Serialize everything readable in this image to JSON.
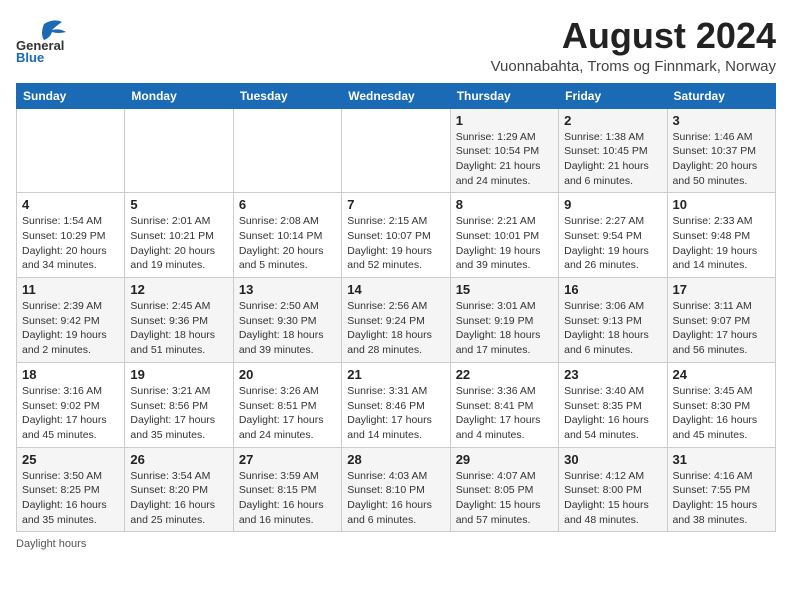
{
  "logo": {
    "line1": "General",
    "line2": "Blue"
  },
  "title": "August 2024",
  "subtitle": "Vuonnabahta, Troms og Finnmark, Norway",
  "days_of_week": [
    "Sunday",
    "Monday",
    "Tuesday",
    "Wednesday",
    "Thursday",
    "Friday",
    "Saturday"
  ],
  "weeks": [
    [
      {
        "day": "",
        "info": ""
      },
      {
        "day": "",
        "info": ""
      },
      {
        "day": "",
        "info": ""
      },
      {
        "day": "",
        "info": ""
      },
      {
        "day": "1",
        "info": "Sunrise: 1:29 AM\nSunset: 10:54 PM\nDaylight: 21 hours and 24 minutes."
      },
      {
        "day": "2",
        "info": "Sunrise: 1:38 AM\nSunset: 10:45 PM\nDaylight: 21 hours and 6 minutes."
      },
      {
        "day": "3",
        "info": "Sunrise: 1:46 AM\nSunset: 10:37 PM\nDaylight: 20 hours and 50 minutes."
      }
    ],
    [
      {
        "day": "4",
        "info": "Sunrise: 1:54 AM\nSunset: 10:29 PM\nDaylight: 20 hours and 34 minutes."
      },
      {
        "day": "5",
        "info": "Sunrise: 2:01 AM\nSunset: 10:21 PM\nDaylight: 20 hours and 19 minutes."
      },
      {
        "day": "6",
        "info": "Sunrise: 2:08 AM\nSunset: 10:14 PM\nDaylight: 20 hours and 5 minutes."
      },
      {
        "day": "7",
        "info": "Sunrise: 2:15 AM\nSunset: 10:07 PM\nDaylight: 19 hours and 52 minutes."
      },
      {
        "day": "8",
        "info": "Sunrise: 2:21 AM\nSunset: 10:01 PM\nDaylight: 19 hours and 39 minutes."
      },
      {
        "day": "9",
        "info": "Sunrise: 2:27 AM\nSunset: 9:54 PM\nDaylight: 19 hours and 26 minutes."
      },
      {
        "day": "10",
        "info": "Sunrise: 2:33 AM\nSunset: 9:48 PM\nDaylight: 19 hours and 14 minutes."
      }
    ],
    [
      {
        "day": "11",
        "info": "Sunrise: 2:39 AM\nSunset: 9:42 PM\nDaylight: 19 hours and 2 minutes."
      },
      {
        "day": "12",
        "info": "Sunrise: 2:45 AM\nSunset: 9:36 PM\nDaylight: 18 hours and 51 minutes."
      },
      {
        "day": "13",
        "info": "Sunrise: 2:50 AM\nSunset: 9:30 PM\nDaylight: 18 hours and 39 minutes."
      },
      {
        "day": "14",
        "info": "Sunrise: 2:56 AM\nSunset: 9:24 PM\nDaylight: 18 hours and 28 minutes."
      },
      {
        "day": "15",
        "info": "Sunrise: 3:01 AM\nSunset: 9:19 PM\nDaylight: 18 hours and 17 minutes."
      },
      {
        "day": "16",
        "info": "Sunrise: 3:06 AM\nSunset: 9:13 PM\nDaylight: 18 hours and 6 minutes."
      },
      {
        "day": "17",
        "info": "Sunrise: 3:11 AM\nSunset: 9:07 PM\nDaylight: 17 hours and 56 minutes."
      }
    ],
    [
      {
        "day": "18",
        "info": "Sunrise: 3:16 AM\nSunset: 9:02 PM\nDaylight: 17 hours and 45 minutes."
      },
      {
        "day": "19",
        "info": "Sunrise: 3:21 AM\nSunset: 8:56 PM\nDaylight: 17 hours and 35 minutes."
      },
      {
        "day": "20",
        "info": "Sunrise: 3:26 AM\nSunset: 8:51 PM\nDaylight: 17 hours and 24 minutes."
      },
      {
        "day": "21",
        "info": "Sunrise: 3:31 AM\nSunset: 8:46 PM\nDaylight: 17 hours and 14 minutes."
      },
      {
        "day": "22",
        "info": "Sunrise: 3:36 AM\nSunset: 8:41 PM\nDaylight: 17 hours and 4 minutes."
      },
      {
        "day": "23",
        "info": "Sunrise: 3:40 AM\nSunset: 8:35 PM\nDaylight: 16 hours and 54 minutes."
      },
      {
        "day": "24",
        "info": "Sunrise: 3:45 AM\nSunset: 8:30 PM\nDaylight: 16 hours and 45 minutes."
      }
    ],
    [
      {
        "day": "25",
        "info": "Sunrise: 3:50 AM\nSunset: 8:25 PM\nDaylight: 16 hours and 35 minutes."
      },
      {
        "day": "26",
        "info": "Sunrise: 3:54 AM\nSunset: 8:20 PM\nDaylight: 16 hours and 25 minutes."
      },
      {
        "day": "27",
        "info": "Sunrise: 3:59 AM\nSunset: 8:15 PM\nDaylight: 16 hours and 16 minutes."
      },
      {
        "day": "28",
        "info": "Sunrise: 4:03 AM\nSunset: 8:10 PM\nDaylight: 16 hours and 6 minutes."
      },
      {
        "day": "29",
        "info": "Sunrise: 4:07 AM\nSunset: 8:05 PM\nDaylight: 15 hours and 57 minutes."
      },
      {
        "day": "30",
        "info": "Sunrise: 4:12 AM\nSunset: 8:00 PM\nDaylight: 15 hours and 48 minutes."
      },
      {
        "day": "31",
        "info": "Sunrise: 4:16 AM\nSunset: 7:55 PM\nDaylight: 15 hours and 38 minutes."
      }
    ]
  ],
  "footer": "Daylight hours"
}
